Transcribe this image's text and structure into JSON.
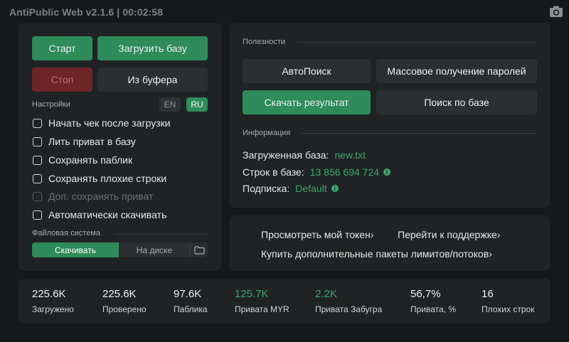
{
  "app": {
    "title": "AntiPublic Web v2.1.6 | 00:02:58"
  },
  "left": {
    "start_label": "Старт",
    "load_base_label": "Загрузить базу",
    "stop_label": "Стоп",
    "from_buffer_label": "Из буфера",
    "settings_label": "Настройки",
    "lang_en": "EN",
    "lang_ru": "RU",
    "lang_selected": "RU",
    "checkboxes": [
      {
        "label": "Начать чек после загрузки",
        "checked": false,
        "disabled": false
      },
      {
        "label": "Лить приват в базу",
        "checked": false,
        "disabled": false
      },
      {
        "label": "Сохранять паблик",
        "checked": false,
        "disabled": false
      },
      {
        "label": "Сохранять плохие строки",
        "checked": false,
        "disabled": false
      },
      {
        "label": "Доп. сохранять приват",
        "checked": false,
        "disabled": true
      },
      {
        "label": "Автоматически скачивать",
        "checked": false,
        "disabled": false
      }
    ],
    "fs_label": "Файловая система",
    "fs_options": [
      "Скачивать",
      "На диске"
    ],
    "fs_selected": "Скачивать"
  },
  "right": {
    "utilities_label": "Полезности",
    "autosearch_label": "АвтоПоиск",
    "mass_passwords_label": "Массовое получение паролей",
    "download_result_label": "Скачать результат",
    "search_base_label": "Поиск по базе",
    "info_label": "Информация",
    "info": [
      {
        "key": "Загруженная база:",
        "value": "new.txt",
        "has_icon": false
      },
      {
        "key": "Строк в базе:",
        "value": "13 856 694 724",
        "has_icon": true
      },
      {
        "key": "Подписка:",
        "value": "Default",
        "has_icon": true
      }
    ]
  },
  "links": {
    "token": "Просмотреть мой токен",
    "support": "Перейти к поддержке",
    "buy": "Купить дополнительные пакеты лимитов/потоков",
    "chevron": "›"
  },
  "stats": [
    {
      "value": "225.6K",
      "label": "Загружено"
    },
    {
      "value": "225.6K",
      "label": "Проверено"
    },
    {
      "value": "97.6K",
      "label": "Паблика"
    },
    {
      "value": "125.7K",
      "label": "Привата MYR"
    },
    {
      "value": "2.2K",
      "label": "Привата Забугра"
    },
    {
      "value": "56,7%",
      "label": "Привата, %"
    },
    {
      "value": "16",
      "label": "Плохих строк"
    }
  ],
  "colors": {
    "accent": "#2e8b5a",
    "accent_text": "#3aa76f",
    "danger": "#6e2528",
    "panel": "#202324",
    "background": "#161819"
  }
}
